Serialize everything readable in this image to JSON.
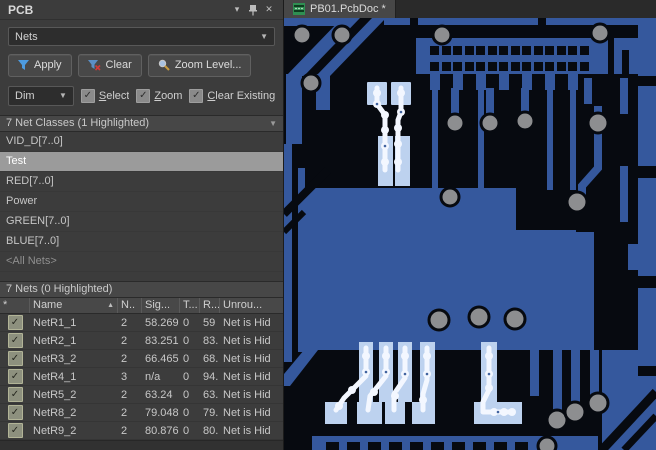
{
  "panel": {
    "title": "PCB",
    "mode_selector": "Nets",
    "buttons": {
      "apply": "Apply",
      "clear": "Clear",
      "zoom_level": "Zoom Level..."
    },
    "dim": {
      "value": "Dim",
      "checkboxes": [
        {
          "label": "Select",
          "checked": true
        },
        {
          "label": "Zoom",
          "checked": true
        },
        {
          "label": "Clear Existing",
          "checked": true
        }
      ]
    },
    "classes": {
      "header": "7 Net Classes (1 Highlighted)",
      "items": [
        {
          "label": "VID_D[7..0]",
          "state": "normal"
        },
        {
          "label": "Test",
          "state": "selected"
        },
        {
          "label": "RED[7..0]",
          "state": "normal"
        },
        {
          "label": "Power",
          "state": "normal"
        },
        {
          "label": "GREEN[7..0]",
          "state": "normal"
        },
        {
          "label": "BLUE[7..0]",
          "state": "normal"
        },
        {
          "label": "<All Nets>",
          "state": "muted"
        }
      ]
    },
    "nets": {
      "header": "7 Nets (0 Highlighted)",
      "columns": [
        "*",
        "Name",
        "N..",
        "Sig...",
        "T...",
        "R...",
        "Unrou..."
      ],
      "rows": [
        {
          "checked": true,
          "name": "NetR1_1",
          "n": "2",
          "sig": "58.269",
          "t": "0",
          "r": "59",
          "unrouted": "Net is Hid"
        },
        {
          "checked": true,
          "name": "NetR2_1",
          "n": "2",
          "sig": "83.251",
          "t": "0",
          "r": "83.",
          "unrouted": "Net is Hid"
        },
        {
          "checked": true,
          "name": "NetR3_2",
          "n": "2",
          "sig": "66.465",
          "t": "0",
          "r": "68.",
          "unrouted": "Net is Hid"
        },
        {
          "checked": true,
          "name": "NetR4_1",
          "n": "3",
          "sig": "n/a",
          "t": "0",
          "r": "94.",
          "unrouted": "Net is Hid"
        },
        {
          "checked": true,
          "name": "NetR5_2",
          "n": "2",
          "sig": "63.24",
          "t": "0",
          "r": "63.",
          "unrouted": "Net is Hid"
        },
        {
          "checked": true,
          "name": "NetR8_2",
          "n": "2",
          "sig": "79.048",
          "t": "0",
          "r": "79.",
          "unrouted": "Net is Hid"
        },
        {
          "checked": true,
          "name": "NetR9_2",
          "n": "2",
          "sig": "80.876",
          "t": "0",
          "r": "80.",
          "unrouted": "Net is Hid"
        }
      ]
    }
  },
  "editor": {
    "tab": "PB01.PcbDoc *"
  },
  "colors": {
    "panel_bg": "#3c3c3c",
    "selected_row": "#9b9b9b",
    "pcb_background": "#070a10",
    "pcb_copper_dimmed": "#35589d",
    "pcb_highlight_pad": "#bdd2ef",
    "pcb_highlight_trace": "#f3f7ff",
    "via_gray": "#8d8e90"
  }
}
